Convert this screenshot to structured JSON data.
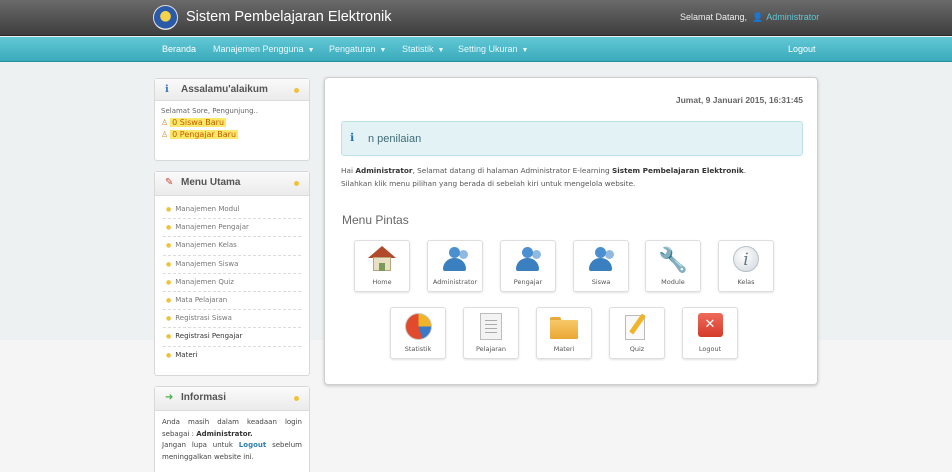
{
  "header": {
    "app_title": "Sistem Pembelajaran Elektronik",
    "welcome_label": "Selamat Datang,",
    "user_name": "Administrator"
  },
  "nav": {
    "items": [
      {
        "label": "Beranda",
        "has_caret": false
      },
      {
        "label": "Manajemen Pengguna",
        "has_caret": true
      },
      {
        "label": "Pengaturan",
        "has_caret": true
      },
      {
        "label": "Statistik",
        "has_caret": true
      },
      {
        "label": "Setting Ukuran",
        "has_caret": true
      }
    ],
    "logout": "Logout",
    "caret": "▼"
  },
  "greeting_panel": {
    "title": "Assalamu'alaikum",
    "greeting": "Selamat Sore, Pengunjung..",
    "stats": [
      "0 Siswa Baru",
      "0 Pengajar Baru"
    ]
  },
  "menu_panel": {
    "title": "Menu Utama",
    "items": [
      "Manajemen Modul",
      "Manajemen Pengajar",
      "Manajemen Kelas",
      "Manajemen Siswa",
      "Manajemen Quiz",
      "Mata Pelajaran",
      "Registrasi Siswa",
      "Registrasi Pengajar",
      "Materi"
    ]
  },
  "info_panel": {
    "title": "Informasi",
    "line1": "Anda masih dalam keadaan login sebagai :",
    "role": "Administrator.",
    "line2_pre": "Jangan lupa untuk",
    "logout_link": "Logout",
    "line2_post": "sebelum meninggalkan website ini."
  },
  "main": {
    "date": "Jumat, 9 Januari 2015, 16:31:45",
    "notice": "n penilaian",
    "intro_hai": "Hai",
    "intro_user": "Administrator",
    "intro_mid": ", Selamat datang di halaman Administrator E-learning",
    "intro_system": "Sistem Pembelajaran Elektronik",
    "intro_line2": "Silahkan klik menu pilihan yang berada di sebelah kiri untuk mengelola website.",
    "shortcuts_title": "Menu Pintas",
    "shortcuts": [
      {
        "label": "Home",
        "icon": "home-icon"
      },
      {
        "label": "Administrator",
        "icon": "user-group-icon"
      },
      {
        "label": "Pengajar",
        "icon": "user-group-icon"
      },
      {
        "label": "Siswa",
        "icon": "user-group-icon"
      },
      {
        "label": "Module",
        "icon": "wrench-icon"
      },
      {
        "label": "Kelas",
        "icon": "info-icon"
      },
      {
        "label": "Statistik",
        "icon": "pie-chart-icon"
      },
      {
        "label": "Pelajaran",
        "icon": "document-icon"
      },
      {
        "label": "Materi",
        "icon": "folder-icon"
      },
      {
        "label": "Quiz",
        "icon": "quiz-edit-icon"
      },
      {
        "label": "Logout",
        "icon": "logout-x-icon"
      }
    ]
  },
  "colors": {
    "topbar": "#4a4a4a",
    "navbar": "#4cb9c9",
    "highlight": "#fde86a",
    "bullet": "#f0c23c"
  }
}
